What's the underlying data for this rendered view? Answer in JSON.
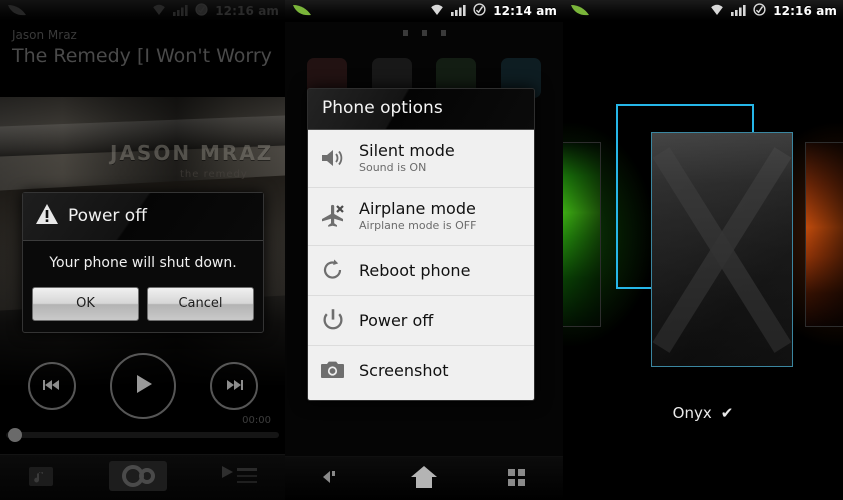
{
  "panels": {
    "music_player": {
      "statusbar": {
        "time": "12:16 am",
        "icons": [
          "leaf-icon",
          "wifi-icon",
          "signal-icon",
          "sync-icon"
        ]
      },
      "artist": "Jason Mraz",
      "track": "The Remedy [I Won't Worry",
      "album_art_title": "JASON MRAZ",
      "album_art_subtitle": "the remedy",
      "elapsed": "00:00",
      "controls": [
        "previous-icon",
        "play-icon",
        "next-icon"
      ],
      "bottom_bar": [
        "library-icon",
        "shuffle-icon",
        "playlist-icon"
      ],
      "dialog": {
        "icon": "warning-icon",
        "title": "Power off",
        "message": "Your phone will shut down.",
        "ok_label": "OK",
        "cancel_label": "Cancel"
      }
    },
    "phone_options": {
      "statusbar": {
        "time": "12:14 am",
        "icons": [
          "leaf-icon",
          "wifi-icon",
          "signal-icon",
          "sync-icon"
        ]
      },
      "popup_title": "Phone options",
      "items": [
        {
          "icon": "speaker-icon",
          "label": "Silent mode",
          "sub": "Sound is ON"
        },
        {
          "icon": "airplane-icon",
          "label": "Airplane mode",
          "sub": "Airplane mode is OFF"
        },
        {
          "icon": "reboot-icon",
          "label": "Reboot phone",
          "sub": ""
        },
        {
          "icon": "power-icon",
          "label": "Power off",
          "sub": ""
        },
        {
          "icon": "camera-icon",
          "label": "Screenshot",
          "sub": ""
        }
      ],
      "navbar": [
        "back-icon",
        "home-icon",
        "recents-icon"
      ]
    },
    "theme_picker": {
      "statusbar": {
        "time": "12:16 am",
        "icons": [
          "leaf-icon",
          "wifi-icon",
          "signal-icon",
          "sync-icon"
        ]
      },
      "selected_theme": "Onyx",
      "selected_mark": "✔",
      "selection_color": "#26b7e8",
      "themes": [
        {
          "name": "green-theme",
          "color": "#3fd014"
        },
        {
          "name": "onyx-theme",
          "color": "#2c2c2c"
        },
        {
          "name": "orange-theme",
          "color": "#e0570e"
        }
      ]
    }
  }
}
